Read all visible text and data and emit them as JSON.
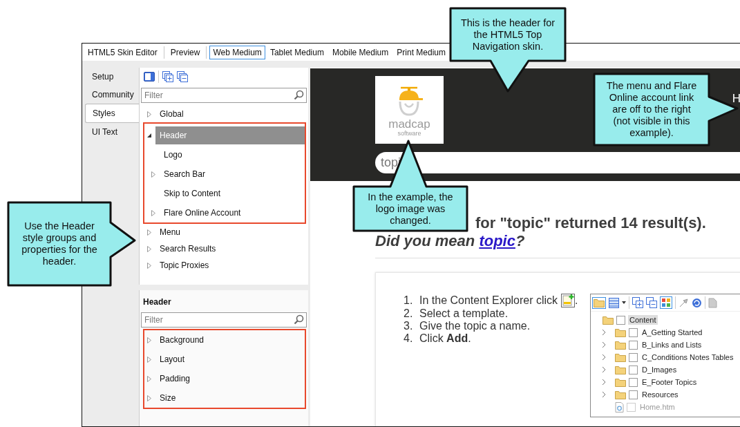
{
  "toolbar": {
    "groups": [
      [
        {
          "label": "HTML5 Skin Editor",
          "selected": false
        }
      ],
      [
        {
          "label": "Preview",
          "selected": false
        }
      ],
      [
        {
          "label": "Web Medium",
          "selected": true
        },
        {
          "label": "Tablet Medium",
          "selected": false
        },
        {
          "label": "Mobile Medium",
          "selected": false
        },
        {
          "label": "Print Medium",
          "selected": false
        }
      ]
    ]
  },
  "side_tabs": [
    {
      "label": "Setup",
      "selected": false
    },
    {
      "label": "Community",
      "selected": false
    },
    {
      "label": "Styles",
      "selected": true
    },
    {
      "label": "UI Text",
      "selected": false
    }
  ],
  "styles_panel": {
    "filter": {
      "placeholder": "Filter"
    },
    "tree": [
      {
        "label": "Global",
        "kind": "group",
        "expanded": false,
        "selected": false,
        "highlighted": false
      },
      {
        "label": "Header",
        "kind": "group",
        "expanded": true,
        "selected": true,
        "highlighted": true,
        "children": [
          {
            "label": "Logo",
            "kind": "leaf",
            "selected": false
          },
          {
            "label": "Search Bar",
            "kind": "group",
            "expanded": false,
            "selected": false
          },
          {
            "label": "Skip to Content",
            "kind": "leaf",
            "selected": false
          },
          {
            "label": "Flare Online Account",
            "kind": "group",
            "expanded": false,
            "selected": false
          }
        ]
      },
      {
        "label": "Menu",
        "kind": "group",
        "expanded": false,
        "selected": false,
        "highlighted": false
      },
      {
        "label": "Search Results",
        "kind": "group",
        "expanded": false,
        "selected": false,
        "highlighted": false
      },
      {
        "label": "Topic Proxies",
        "kind": "group",
        "expanded": false,
        "selected": false,
        "highlighted": false
      }
    ]
  },
  "properties_panel": {
    "title": "Header",
    "filter": {
      "placeholder": "Filter"
    },
    "highlighted": true,
    "items": [
      {
        "label": "Background",
        "expanded": false
      },
      {
        "label": "Layout",
        "expanded": false
      },
      {
        "label": "Padding",
        "expanded": false
      },
      {
        "label": "Size",
        "expanded": false
      }
    ]
  },
  "preview": {
    "logo": {
      "wordmark": "madcap",
      "tagline": "software"
    },
    "nav_item": "H",
    "search": {
      "value": "topi"
    },
    "results": {
      "heading": "for \"topic\" returned 14 result(s).",
      "suggestion": {
        "text": "Did you mean",
        "link": "topic",
        "suffix": "?"
      }
    },
    "steps": [
      {
        "number": "1.",
        "text": "In the Content Explorer click",
        "kind": "with-icon",
        "suffix": "."
      },
      {
        "number": "2.",
        "text": "Select a template.",
        "kind": "text"
      },
      {
        "number": "3.",
        "text": "Give the topic a name.",
        "kind": "text"
      },
      {
        "number": "4.",
        "text": "Click **Add**.",
        "kind": "text"
      }
    ],
    "content_explorer": {
      "root": {
        "label": "Content",
        "selected": true,
        "checked": false,
        "children": [
          {
            "label": "A_Getting Started",
            "kind": "folder",
            "expanded": false,
            "selected": false,
            "checked": false,
            "disabled": false
          },
          {
            "label": "B_Links and Lists",
            "kind": "folder",
            "expanded": false,
            "selected": false,
            "checked": false,
            "disabled": false
          },
          {
            "label": "C_Conditions Notes Tables",
            "kind": "folder",
            "expanded": false,
            "selected": false,
            "checked": false,
            "disabled": false
          },
          {
            "label": "D_Images",
            "kind": "folder",
            "expanded": false,
            "selected": false,
            "checked": false,
            "disabled": false
          },
          {
            "label": "E_Footer Topics",
            "kind": "folder",
            "expanded": false,
            "selected": false,
            "checked": false,
            "disabled": false
          },
          {
            "label": "Resources",
            "kind": "folder",
            "expanded": false,
            "selected": false,
            "checked": false,
            "disabled": false
          },
          {
            "label": "Home.htm",
            "kind": "file",
            "selected": false,
            "checked": false,
            "disabled": true
          }
        ]
      }
    }
  },
  "callouts": [
    {
      "text": "This is the header for the HTML5 Top Navigation skin."
    },
    {
      "text": "The menu and Flare Online account link are off to the right (not visible in this example)."
    },
    {
      "text": "In the example, the logo image was changed."
    },
    {
      "text": "Use the Header style groups and properties for the header."
    }
  ]
}
